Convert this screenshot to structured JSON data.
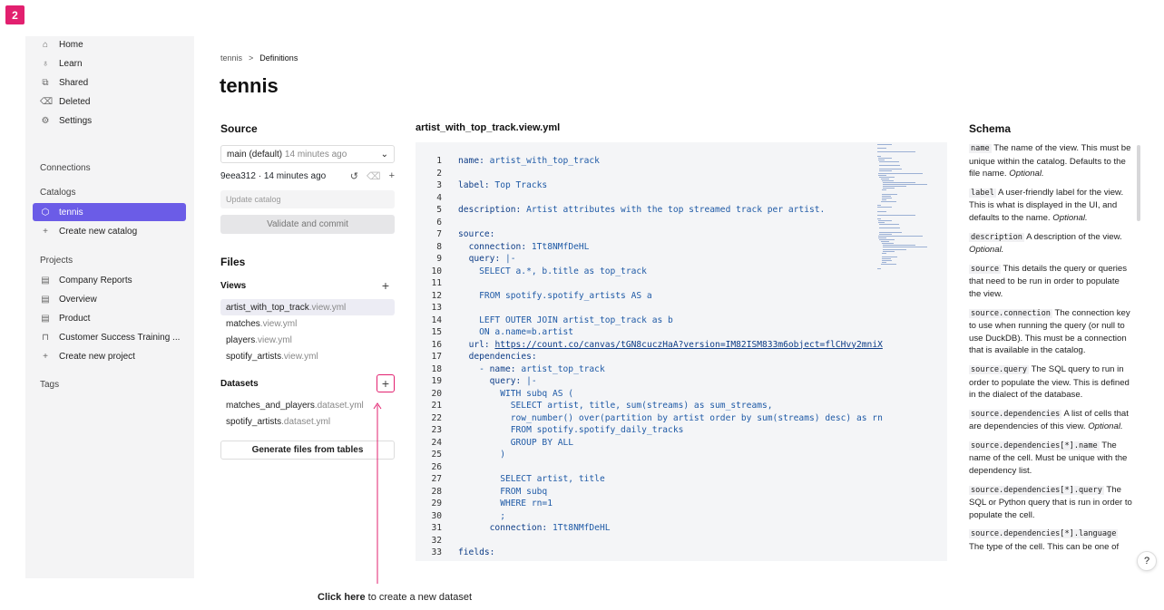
{
  "step_badge": "2",
  "sidebar": {
    "nav": [
      {
        "label": "Home",
        "icon": "home-icon"
      },
      {
        "label": "Learn",
        "icon": "lightbulb-icon"
      },
      {
        "label": "Shared",
        "icon": "shared-icon"
      },
      {
        "label": "Deleted",
        "icon": "trash-icon"
      },
      {
        "label": "Settings",
        "icon": "gear-icon"
      }
    ],
    "connections_header": "Connections",
    "catalogs_header": "Catalogs",
    "catalogs": [
      {
        "label": "tennis",
        "active": true
      },
      {
        "label": "Create new catalog"
      }
    ],
    "projects_header": "Projects",
    "projects": [
      {
        "label": "Company Reports"
      },
      {
        "label": "Overview"
      },
      {
        "label": "Product"
      },
      {
        "label": "Customer Success Training ..."
      },
      {
        "label": "Create new project"
      }
    ],
    "tags_header": "Tags"
  },
  "breadcrumb": {
    "root": "tennis",
    "sep": ">",
    "current": "Definitions"
  },
  "page_title": "tennis",
  "source": {
    "title": "Source",
    "branch_name": "main (default)",
    "branch_time": "14 minutes ago",
    "commit": "9eea312 · 14 minutes ago",
    "update_placeholder": "Update catalog",
    "validate_label": "Validate and commit"
  },
  "files": {
    "title": "Files",
    "views_label": "Views",
    "views": [
      {
        "name": "artist_with_top_track",
        "ext": ".view.yml",
        "selected": true
      },
      {
        "name": "matches",
        "ext": ".view.yml"
      },
      {
        "name": "players",
        "ext": ".view.yml"
      },
      {
        "name": "spotify_artists",
        "ext": ".view.yml"
      }
    ],
    "datasets_label": "Datasets",
    "datasets": [
      {
        "name": "matches_and_players",
        "ext": ".dataset.yml"
      },
      {
        "name": "spotify_artists",
        "ext": ".dataset.yml"
      }
    ],
    "generate_label": "Generate files from tables"
  },
  "editor": {
    "filename": "artist_with_top_track.view.yml",
    "lines": [
      {
        "n": "1",
        "t": "name: artist_with_top_track"
      },
      {
        "n": "2",
        "t": ""
      },
      {
        "n": "3",
        "t": "label: Top Tracks"
      },
      {
        "n": "4",
        "t": ""
      },
      {
        "n": "5",
        "t": "description: Artist attributes with the top streamed track per artist."
      },
      {
        "n": "6",
        "t": ""
      },
      {
        "n": "7",
        "t": "source:"
      },
      {
        "n": "8",
        "t": "  connection: 1Tt8NMfDeHL"
      },
      {
        "n": "9",
        "t": "  query: |-"
      },
      {
        "n": "10",
        "t": "    SELECT a.*, b.title as top_track"
      },
      {
        "n": "11",
        "t": ""
      },
      {
        "n": "12",
        "t": "    FROM spotify.spotify_artists AS a"
      },
      {
        "n": "13",
        "t": ""
      },
      {
        "n": "14",
        "t": "    LEFT OUTER JOIN artist_top_track as b"
      },
      {
        "n": "15",
        "t": "    ON a.name=b.artist"
      },
      {
        "n": "16",
        "t": "  url: https://count.co/canvas/tGN8cuczHaA?version=IM82ISM833m6object=flCHvy2mniX"
      },
      {
        "n": "17",
        "t": "  dependencies:"
      },
      {
        "n": "18",
        "t": "    - name: artist_top_track"
      },
      {
        "n": "19",
        "t": "      query: |-"
      },
      {
        "n": "20",
        "t": "        WITH subq AS ("
      },
      {
        "n": "21",
        "t": "          SELECT artist, title, sum(streams) as sum_streams,"
      },
      {
        "n": "22",
        "t": "          row_number() over(partition by artist order by sum(streams) desc) as rn"
      },
      {
        "n": "23",
        "t": "          FROM spotify.spotify_daily_tracks"
      },
      {
        "n": "24",
        "t": "          GROUP BY ALL"
      },
      {
        "n": "25",
        "t": "        )"
      },
      {
        "n": "26",
        "t": ""
      },
      {
        "n": "27",
        "t": "        SELECT artist, title"
      },
      {
        "n": "28",
        "t": "        FROM subq"
      },
      {
        "n": "29",
        "t": "        WHERE rn=1"
      },
      {
        "n": "30",
        "t": "        ;"
      },
      {
        "n": "31",
        "t": "      connection: 1Tt8NMfDeHL"
      },
      {
        "n": "32",
        "t": ""
      },
      {
        "n": "33",
        "t": "fields:"
      }
    ]
  },
  "schema": {
    "title": "Schema",
    "items": [
      {
        "key": "name",
        "desc": "The name of the view. This must be unique within the catalog. Defaults to the file name.",
        "opt": "Optional."
      },
      {
        "key": "label",
        "desc": "A user-friendly label for the view. This is what is displayed in the UI, and defaults to the name.",
        "opt": "Optional."
      },
      {
        "key": "description",
        "desc": "A description of the view.",
        "opt": "Optional."
      },
      {
        "key": "source",
        "desc": "This details the query or queries that need to be run in order to populate the view.",
        "opt": ""
      },
      {
        "key": "source.connection",
        "desc": "The connection key to use when running the query (or null to use DuckDB). This must be a connection that is available in the catalog.",
        "opt": ""
      },
      {
        "key": "source.query",
        "desc": "The SQL query to run in order to populate the view. This is defined in the dialect of the database.",
        "opt": ""
      },
      {
        "key": "source.dependencies",
        "desc": "A list of cells that are dependencies of this view.",
        "opt": "Optional."
      },
      {
        "key": "source.dependencies[*].name",
        "desc": "The name of the cell. Must be unique with the dependency list.",
        "opt": ""
      },
      {
        "key": "source.dependencies[*].query",
        "desc": "The SQL or Python query that is run in order to populate the cell.",
        "opt": ""
      },
      {
        "key": "source.dependencies[*].language",
        "desc": "The type of the cell. This can be one of",
        "opt": ""
      }
    ]
  },
  "help_label": "?",
  "callout": {
    "bold": "Click here",
    "rest": " to create a new dataset"
  },
  "colors": {
    "accent": "#6b5ce7",
    "highlight": "#e2206f"
  }
}
